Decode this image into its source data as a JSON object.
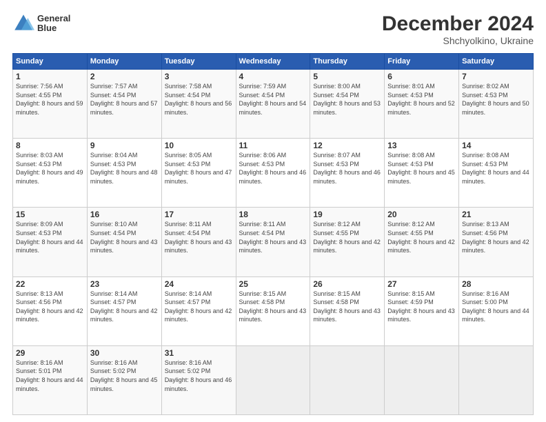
{
  "logo": {
    "line1": "General",
    "line2": "Blue"
  },
  "title": "December 2024",
  "subtitle": "Shchyolkino, Ukraine",
  "days_header": [
    "Sunday",
    "Monday",
    "Tuesday",
    "Wednesday",
    "Thursday",
    "Friday",
    "Saturday"
  ],
  "weeks": [
    [
      {
        "day": "1",
        "sunrise": "7:56 AM",
        "sunset": "4:55 PM",
        "daylight": "8 hours and 59 minutes."
      },
      {
        "day": "2",
        "sunrise": "7:57 AM",
        "sunset": "4:54 PM",
        "daylight": "8 hours and 57 minutes."
      },
      {
        "day": "3",
        "sunrise": "7:58 AM",
        "sunset": "4:54 PM",
        "daylight": "8 hours and 56 minutes."
      },
      {
        "day": "4",
        "sunrise": "7:59 AM",
        "sunset": "4:54 PM",
        "daylight": "8 hours and 54 minutes."
      },
      {
        "day": "5",
        "sunrise": "8:00 AM",
        "sunset": "4:54 PM",
        "daylight": "8 hours and 53 minutes."
      },
      {
        "day": "6",
        "sunrise": "8:01 AM",
        "sunset": "4:53 PM",
        "daylight": "8 hours and 52 minutes."
      },
      {
        "day": "7",
        "sunrise": "8:02 AM",
        "sunset": "4:53 PM",
        "daylight": "8 hours and 50 minutes."
      }
    ],
    [
      {
        "day": "8",
        "sunrise": "8:03 AM",
        "sunset": "4:53 PM",
        "daylight": "8 hours and 49 minutes."
      },
      {
        "day": "9",
        "sunrise": "8:04 AM",
        "sunset": "4:53 PM",
        "daylight": "8 hours and 48 minutes."
      },
      {
        "day": "10",
        "sunrise": "8:05 AM",
        "sunset": "4:53 PM",
        "daylight": "8 hours and 47 minutes."
      },
      {
        "day": "11",
        "sunrise": "8:06 AM",
        "sunset": "4:53 PM",
        "daylight": "8 hours and 46 minutes."
      },
      {
        "day": "12",
        "sunrise": "8:07 AM",
        "sunset": "4:53 PM",
        "daylight": "8 hours and 46 minutes."
      },
      {
        "day": "13",
        "sunrise": "8:08 AM",
        "sunset": "4:53 PM",
        "daylight": "8 hours and 45 minutes."
      },
      {
        "day": "14",
        "sunrise": "8:08 AM",
        "sunset": "4:53 PM",
        "daylight": "8 hours and 44 minutes."
      }
    ],
    [
      {
        "day": "15",
        "sunrise": "8:09 AM",
        "sunset": "4:53 PM",
        "daylight": "8 hours and 44 minutes."
      },
      {
        "day": "16",
        "sunrise": "8:10 AM",
        "sunset": "4:54 PM",
        "daylight": "8 hours and 43 minutes."
      },
      {
        "day": "17",
        "sunrise": "8:11 AM",
        "sunset": "4:54 PM",
        "daylight": "8 hours and 43 minutes."
      },
      {
        "day": "18",
        "sunrise": "8:11 AM",
        "sunset": "4:54 PM",
        "daylight": "8 hours and 43 minutes."
      },
      {
        "day": "19",
        "sunrise": "8:12 AM",
        "sunset": "4:55 PM",
        "daylight": "8 hours and 42 minutes."
      },
      {
        "day": "20",
        "sunrise": "8:12 AM",
        "sunset": "4:55 PM",
        "daylight": "8 hours and 42 minutes."
      },
      {
        "day": "21",
        "sunrise": "8:13 AM",
        "sunset": "4:56 PM",
        "daylight": "8 hours and 42 minutes."
      }
    ],
    [
      {
        "day": "22",
        "sunrise": "8:13 AM",
        "sunset": "4:56 PM",
        "daylight": "8 hours and 42 minutes."
      },
      {
        "day": "23",
        "sunrise": "8:14 AM",
        "sunset": "4:57 PM",
        "daylight": "8 hours and 42 minutes."
      },
      {
        "day": "24",
        "sunrise": "8:14 AM",
        "sunset": "4:57 PM",
        "daylight": "8 hours and 42 minutes."
      },
      {
        "day": "25",
        "sunrise": "8:15 AM",
        "sunset": "4:58 PM",
        "daylight": "8 hours and 43 minutes."
      },
      {
        "day": "26",
        "sunrise": "8:15 AM",
        "sunset": "4:58 PM",
        "daylight": "8 hours and 43 minutes."
      },
      {
        "day": "27",
        "sunrise": "8:15 AM",
        "sunset": "4:59 PM",
        "daylight": "8 hours and 43 minutes."
      },
      {
        "day": "28",
        "sunrise": "8:16 AM",
        "sunset": "5:00 PM",
        "daylight": "8 hours and 44 minutes."
      }
    ],
    [
      {
        "day": "29",
        "sunrise": "8:16 AM",
        "sunset": "5:01 PM",
        "daylight": "8 hours and 44 minutes."
      },
      {
        "day": "30",
        "sunrise": "8:16 AM",
        "sunset": "5:02 PM",
        "daylight": "8 hours and 45 minutes."
      },
      {
        "day": "31",
        "sunrise": "8:16 AM",
        "sunset": "5:02 PM",
        "daylight": "8 hours and 46 minutes."
      },
      null,
      null,
      null,
      null
    ]
  ]
}
